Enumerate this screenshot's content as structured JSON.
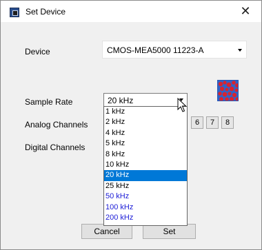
{
  "window": {
    "title": "Set Device",
    "close_glyph": "✕"
  },
  "form": {
    "device_label": "Device",
    "device_value": "CMOS-MEA5000 11223-A",
    "sample_rate_label": "Sample Rate",
    "sample_rate_value": "20 kHz",
    "analog_label": "Analog Channels",
    "digital_label": "Digital Channels"
  },
  "analog_channel_buttons": [
    "6",
    "7",
    "8"
  ],
  "dropdown": {
    "options": [
      "1 kHz",
      "2 kHz",
      "4 kHz",
      "5 kHz",
      "8 kHz",
      "10 kHz",
      "20 kHz",
      "25 kHz",
      "50 kHz",
      "100 kHz",
      "200 kHz"
    ],
    "selected": "20 kHz",
    "blue_options": [
      "50 kHz",
      "100 kHz",
      "200 kHz"
    ]
  },
  "buttons": {
    "cancel": "Cancel",
    "set": "Set"
  },
  "icons": [
    "app-icon",
    "close-icon",
    "mea-chip-icon",
    "chevron-down-icon",
    "mouse-cursor-icon"
  ],
  "colors": {
    "selection": "#0078d7",
    "option_blue": "#1a1ad6",
    "icon_blue": "#2f63c8",
    "icon_red": "#d9232e"
  }
}
